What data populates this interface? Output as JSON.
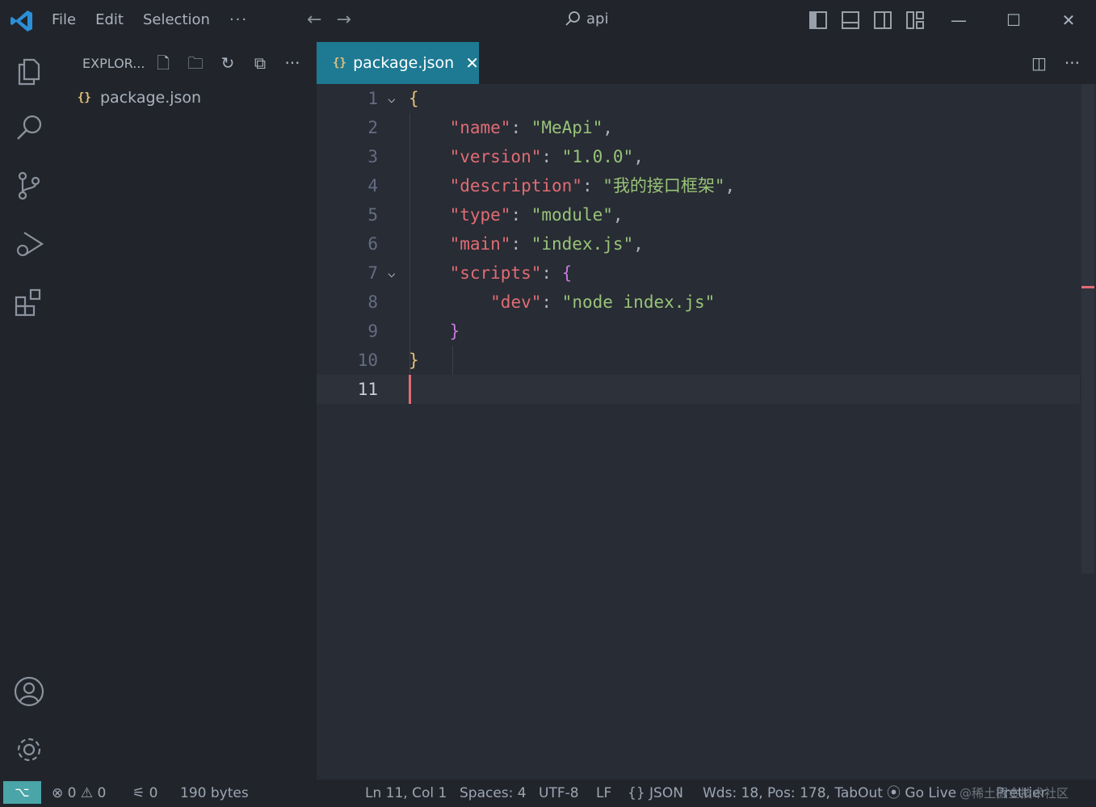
{
  "titlebar": {
    "menu": [
      "File",
      "Edit",
      "Selection",
      "···"
    ],
    "search_label": "api",
    "icons": [
      "vscode-logo-icon",
      "arrow-left-icon",
      "arrow-right-icon",
      "search-icon",
      "toggle-primary-sidebar-icon",
      "toggle-panel-icon",
      "toggle-secondary-sidebar-icon",
      "customize-layout-icon",
      "minimize-icon",
      "maximize-icon",
      "close-icon"
    ]
  },
  "activitybar": {
    "items": [
      "explorer-icon",
      "search-icon",
      "source-control-icon",
      "run-debug-icon",
      "extensions-icon",
      "accounts-icon",
      "manage-gear-icon"
    ]
  },
  "sidebar": {
    "title": "EXPLOR...",
    "files": [
      {
        "name": "package.json",
        "icon": "json-icon"
      }
    ]
  },
  "editor": {
    "tab": {
      "label": "package.json",
      "icon": "json-icon"
    },
    "lines": [
      {
        "n": "1"
      },
      {
        "n": "2"
      },
      {
        "n": "3"
      },
      {
        "n": "4"
      },
      {
        "n": "5"
      },
      {
        "n": "6"
      },
      {
        "n": "7"
      },
      {
        "n": "8"
      },
      {
        "n": "9"
      },
      {
        "n": "10"
      },
      {
        "n": "11"
      }
    ],
    "code": {
      "l2_key": "\"name\"",
      "l2_val": "\"MeApi\"",
      "l3_key": "\"version\"",
      "l3_val": "\"1.0.0\"",
      "l4_key": "\"description\"",
      "l4_val": "\"我的接口框架\"",
      "l5_key": "\"type\"",
      "l5_val": "\"module\"",
      "l6_key": "\"main\"",
      "l6_val": "\"index.js\"",
      "l7_key": "\"scripts\"",
      "l8_key": "\"dev\"",
      "l8_val": "\"node index.js\""
    },
    "colors": {
      "key": "#e06c75",
      "string": "#98c379",
      "brace1": "#e5c07b",
      "brace2": "#c678dd",
      "tab_active": "#1e7a93"
    }
  },
  "statusbar": {
    "errors": "0",
    "warnings": "0",
    "ports": "0",
    "size": "190 bytes",
    "position": "Ln 11, Col 1",
    "spaces": "Spaces: 4",
    "encoding": "UTF-8",
    "eol": "LF",
    "language": "JSON",
    "words": "Wds: 18, Pos: 178, TabOut",
    "golive": "Go Live",
    "prettier": "Prettier",
    "watermark": "@稀土掘金技术社区"
  }
}
